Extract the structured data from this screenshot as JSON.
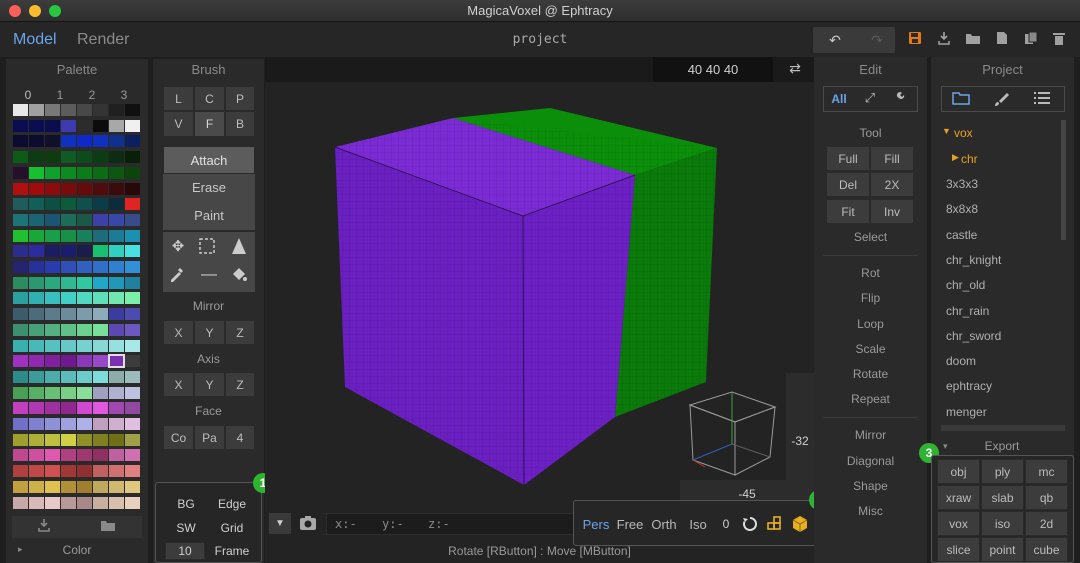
{
  "window": {
    "title": "MagicaVoxel @ Ephtracy"
  },
  "topbar": {
    "tabs": [
      "Model",
      "Render"
    ],
    "project_name": "project",
    "dims": "40  40  40",
    "icons": [
      "undo-icon",
      "redo-icon",
      "save-icon",
      "import-icon",
      "open-folder-icon",
      "new-file-icon",
      "copy-icon",
      "delete-icon"
    ]
  },
  "palette": {
    "title": "Palette",
    "tabs": [
      "0",
      "1",
      "2",
      "3"
    ],
    "footer_label": "Color",
    "colors": [
      [
        "#e8e8e8",
        "#a0a0a0",
        "#787878",
        "#5c5c5c",
        "#484848",
        "#343434",
        "#202020",
        "#101010"
      ],
      [
        "#0c0c50",
        "#0c0c50",
        "#0c0c50",
        "#3c3cb0",
        "#2c2c2c",
        "#0c0c0c",
        "#a8a8a8",
        "#f0f0f0"
      ],
      [
        "#0c0c30",
        "#0c0c30",
        "#10102a",
        "#1030c0",
        "#1028c8",
        "#1030c0",
        "#103090",
        "#0c2060"
      ],
      [
        "#0c5c18",
        "#0c3c14",
        "#0e3c0e",
        "#0e5c24",
        "#0c4c1c",
        "#0c3c14",
        "#0c2c14",
        "#082008"
      ],
      [
        "#24102a",
        "#18c030",
        "#10a02c",
        "#0c8c20",
        "#0c7c18",
        "#0c6c14",
        "#0c5810",
        "#0c440c"
      ],
      [
        "#b01010",
        "#a00c0c",
        "#8c0c0c",
        "#780c0c",
        "#640c0c",
        "#500c0c",
        "#3c0c0c",
        "#280808"
      ],
      [
        "#205c5c",
        "#106058",
        "#0c5044",
        "#0c5c3c",
        "#10504c",
        "#0c3c48",
        "#0c2c3c",
        "#e02424"
      ],
      [
        "#1c7474",
        "#1c6474",
        "#1c5474",
        "#1c6c58",
        "#1c5848",
        "#3c40a8",
        "#3848a8",
        "#384c8c"
      ],
      [
        "#20c030",
        "#18a838",
        "#18a048",
        "#189048",
        "#18805c",
        "#1c6c7c",
        "#1c7c98",
        "#1c90b0"
      ],
      [
        "#2c2c8c",
        "#2c2ca0",
        "#1c1c60",
        "#1c1c6c",
        "#1c1c4c",
        "#18c070",
        "#30d0c0",
        "#48e0e0"
      ],
      [
        "#242470",
        "#28309c",
        "#283cb0",
        "#3050b8",
        "#3060c0",
        "#3070c8",
        "#3080d0",
        "#3090d8"
      ],
      [
        "#2c8c60",
        "#2c9870",
        "#2ca880",
        "#30b890",
        "#30c8a0",
        "#20a8c8",
        "#2098b8",
        "#2080a0"
      ],
      [
        "#2ca0a0",
        "#30b0b0",
        "#38c0c0",
        "#40d0c8",
        "#50d8c0",
        "#60e0b8",
        "#70e8b0",
        "#7cf0a8"
      ],
      [
        "#3c5c6c",
        "#4c6c7c",
        "#5c7c8c",
        "#6c8c9c",
        "#7c9cac",
        "#8cacbc",
        "#3c3ca0",
        "#4c4cb0"
      ],
      [
        "#3c9070",
        "#48a078",
        "#54b080",
        "#60c088",
        "#6cd090",
        "#78e098",
        "#5c48b0",
        "#6c58c0"
      ],
      [
        "#38b0b0",
        "#48b8b8",
        "#58c0c0",
        "#68c8c8",
        "#78d0d0",
        "#88d8d8",
        "#98e0e0",
        "#a8e8e8"
      ],
      [
        "#a030c0",
        "#9028b0",
        "#8020a0",
        "#701890",
        "#8838b8",
        "#9848c8",
        "#7a30b0",
        "#3c3c3c"
      ],
      [
        "#2c8c8c",
        "#3c9c9c",
        "#4cacac",
        "#5cbcbc",
        "#6ccccc",
        "#7cdcdc",
        "#8cacac",
        "#9cbcbc"
      ],
      [
        "#48a058",
        "#58b068",
        "#68c078",
        "#78d088",
        "#88e098",
        "#a0a0c0",
        "#b0b0d0",
        "#c0c0e0"
      ],
      [
        "#c040c0",
        "#b038b0",
        "#a030a0",
        "#902890",
        "#d048d0",
        "#e058e0",
        "#a048b0",
        "#9048a0"
      ],
      [
        "#7070c8",
        "#8080d0",
        "#9090d8",
        "#a0a0e0",
        "#b0b0e8",
        "#c0a0c0",
        "#d0b0d0",
        "#e0c0e0"
      ],
      [
        "#a0a030",
        "#b0b038",
        "#c0c040",
        "#d0d048",
        "#909028",
        "#808020",
        "#707018",
        "#a0a048"
      ],
      [
        "#c04890",
        "#d050a0",
        "#e058b0",
        "#b04080",
        "#a03870",
        "#903060",
        "#c060a0",
        "#d070b0"
      ],
      [
        "#b04040",
        "#c04848",
        "#d05050",
        "#a03838",
        "#903030",
        "#c06060",
        "#d07070",
        "#e08080"
      ],
      [
        "#c0a040",
        "#d0b048",
        "#e0c050",
        "#b09038",
        "#a08030",
        "#c0a860",
        "#d0b870",
        "#e0c880"
      ],
      [
        "#c8a8a8",
        "#d8b8b8",
        "#e8c8c8",
        "#b89898",
        "#a88888",
        "#c8b0a0",
        "#d8c0b0",
        "#e8d0c0"
      ]
    ]
  },
  "brush": {
    "title": "Brush",
    "row1": [
      "L",
      "C",
      "P"
    ],
    "row2": [
      "V",
      "F",
      "B"
    ],
    "modes": [
      "Attach",
      "Erase",
      "Paint"
    ],
    "mirror": {
      "label": "Mirror",
      "buttons": [
        "X",
        "Y",
        "Z"
      ]
    },
    "axis": {
      "label": "Axis",
      "buttons": [
        "X",
        "Y",
        "Z"
      ]
    },
    "face": {
      "label": "Face",
      "buttons": [
        "Co",
        "Pa",
        "4"
      ]
    }
  },
  "display": {
    "bg": "BG",
    "edge": "Edge",
    "sw": "SW",
    "grid": "Grid",
    "frame_value": "10",
    "frame": "Frame"
  },
  "viewport": {
    "coords": {
      "x": "x:-",
      "y": "y:-",
      "z": "z:-"
    },
    "camera_modes": [
      "Pers",
      "Free",
      "Orth",
      "Iso"
    ],
    "zoom_value": "0",
    "status": "Rotate [RButton] : Move [MButton]",
    "ruler_value": "-32",
    "ruler_h_value": "-45",
    "cube_colors": {
      "front": "#6a1fc0",
      "top_left": "#7a2ad0",
      "top_right": "#0a8c0a",
      "side": "#0c7a0c"
    }
  },
  "edit": {
    "title": "Edit",
    "filters": [
      "All"
    ],
    "tool_label": "Tool",
    "tool_buttons": [
      [
        "Full",
        "Fill"
      ],
      [
        "Del",
        "2X"
      ],
      [
        "Fit",
        "Inv"
      ]
    ],
    "select_label": "Select",
    "actions1": [
      "Rot",
      "Flip",
      "Loop",
      "Scale",
      "Rotate",
      "Repeat"
    ],
    "actions2": [
      "Mirror",
      "Diagonal",
      "Shape",
      "Misc"
    ]
  },
  "project": {
    "title": "Project",
    "folder": "vox",
    "subfolder": "chr",
    "items": [
      "3x3x3",
      "8x8x8",
      "castle",
      "chr_knight",
      "chr_old",
      "chr_rain",
      "chr_sword",
      "doom",
      "ephtracy",
      "menger"
    ],
    "export_label": "Export",
    "export_buttons": [
      [
        "obj",
        "ply",
        "mc"
      ],
      [
        "xraw",
        "slab",
        "qb"
      ],
      [
        "vox",
        "iso",
        "2d"
      ],
      [
        "slice",
        "point",
        "cube"
      ]
    ]
  },
  "badges": [
    "1",
    "2",
    "3"
  ]
}
